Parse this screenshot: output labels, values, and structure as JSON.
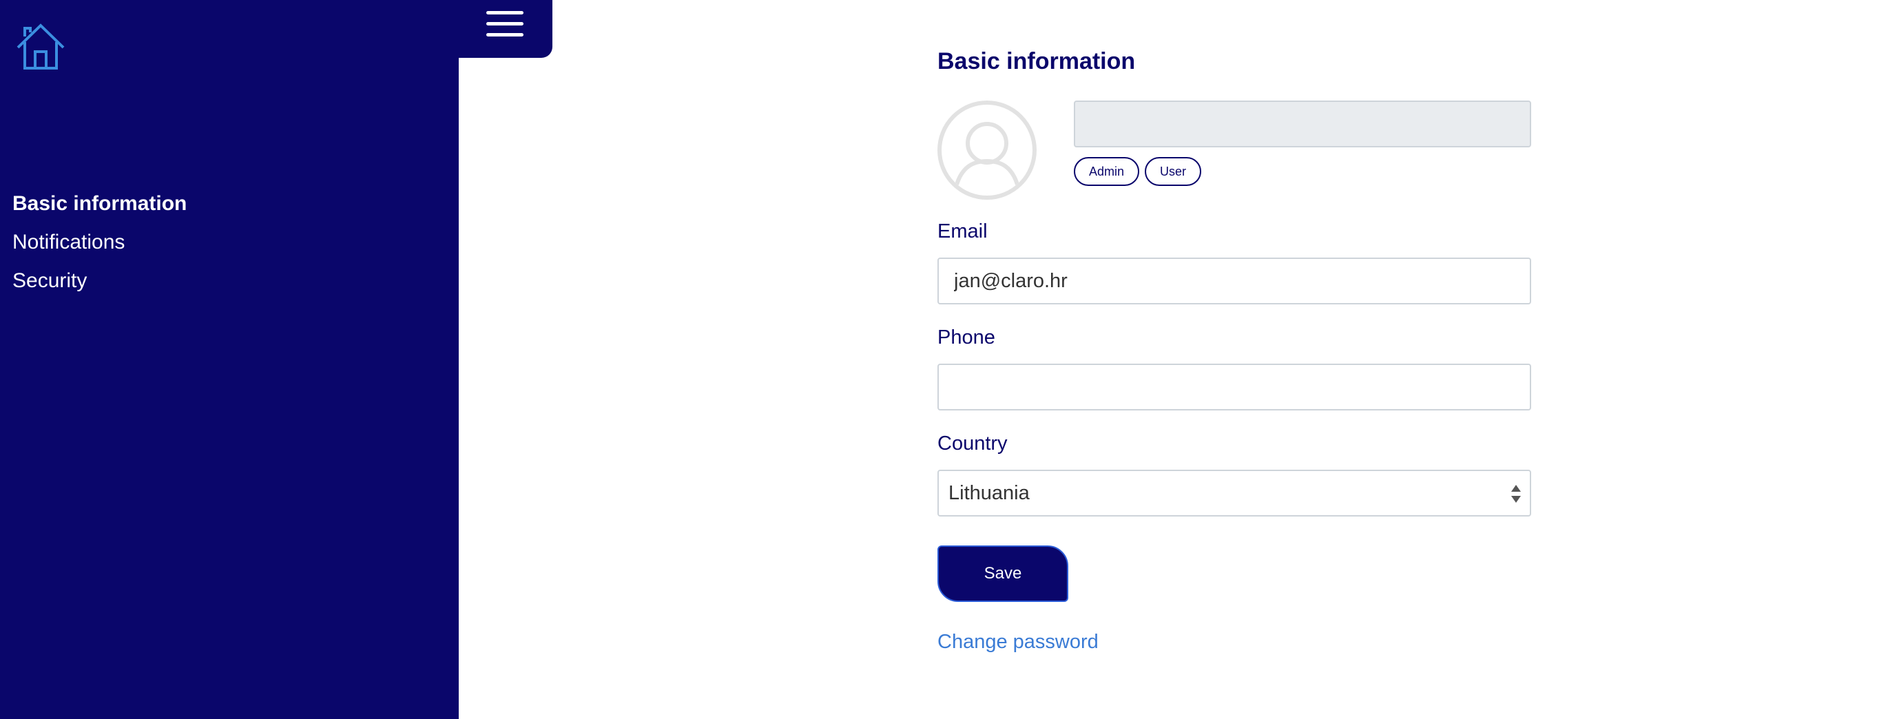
{
  "sidebar": {
    "home_icon": "home-icon",
    "items": [
      {
        "label": "Basic information",
        "active": true
      },
      {
        "label": "Notifications",
        "active": false
      },
      {
        "label": "Security",
        "active": false
      }
    ]
  },
  "header": {
    "menu_icon": "hamburger-menu-icon"
  },
  "main": {
    "title": "Basic information",
    "avatar_icon": "user-avatar-icon",
    "name_field": {
      "value": ""
    },
    "roles": [
      "Admin",
      "User"
    ],
    "email": {
      "label": "Email",
      "value": "jan@claro.hr"
    },
    "phone": {
      "label": "Phone",
      "value": ""
    },
    "country": {
      "label": "Country",
      "value": "Lithuania"
    },
    "save_label": "Save",
    "change_password_label": "Change password"
  },
  "colors": {
    "brand_navy": "#0a066b",
    "link_blue": "#3a7bd5",
    "home_icon_blue": "#3b8fe0",
    "disabled_field": "#e9ecef"
  }
}
